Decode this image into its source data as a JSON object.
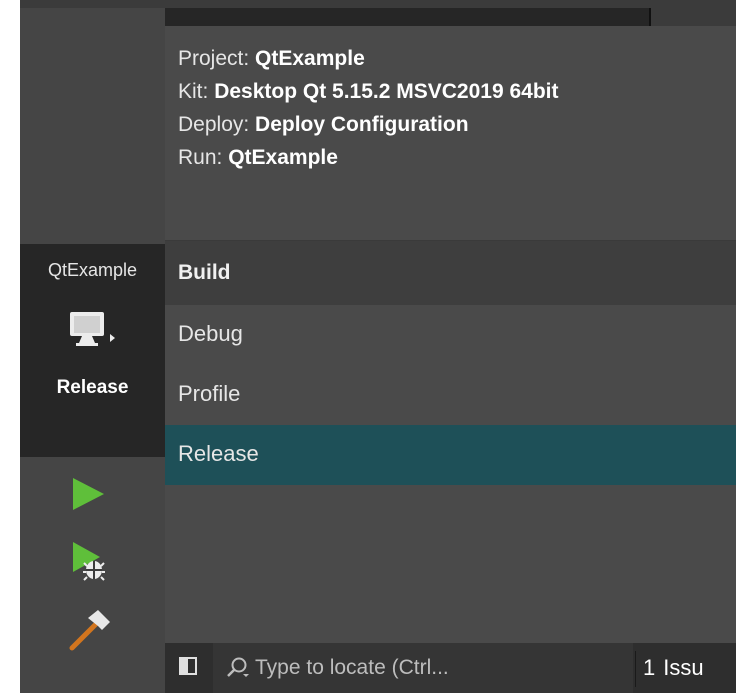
{
  "target_selector": {
    "project_name": "QtExample",
    "build_config": "Release",
    "device_icon": "monitor-icon"
  },
  "sidebar_buttons": {
    "run": "run-icon",
    "debug": "debug-run-icon",
    "build": "hammer-icon"
  },
  "popup": {
    "info": {
      "project_label": "Project:",
      "project_value": "QtExample",
      "kit_label": "Kit:",
      "kit_value": "Desktop Qt 5.15.2 MSVC2019 64bit",
      "deploy_label": "Deploy:",
      "deploy_value": "Deploy Configuration",
      "run_label": "Run:",
      "run_value": "QtExample"
    },
    "build_header": "Build",
    "build_configs": [
      {
        "label": "Debug",
        "selected": false
      },
      {
        "label": "Profile",
        "selected": false
      },
      {
        "label": "Release",
        "selected": true
      }
    ]
  },
  "statusbar": {
    "locator_placeholder": "Type to locate (Ctrl...",
    "issues_count": "1",
    "issues_label": "Issu"
  },
  "colors": {
    "selected_bg": "#1e5058",
    "run_green": "#5fbf3a",
    "hammer_orange": "#d2751e"
  }
}
